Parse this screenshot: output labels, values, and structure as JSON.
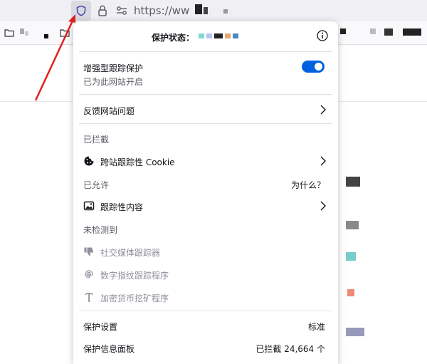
{
  "browser": {
    "url": "https://ww"
  },
  "panel": {
    "header": {
      "status_label": "保护状态："
    },
    "enhanced": {
      "title": "增强型跟踪保护",
      "subtitle": "已为此网站开启",
      "enabled": true
    },
    "report": {
      "label": "反馈网站问题"
    },
    "blocked_section": {
      "label": "已拦截"
    },
    "blocked_items": [
      {
        "label": "跨站跟踪性 Cookie",
        "icon": "cookie-icon"
      }
    ],
    "allowed_section": {
      "label": "已允许",
      "why_link": "为什么？"
    },
    "allowed_items": [
      {
        "label": "跟踪性内容",
        "icon": "image-icon"
      }
    ],
    "not_detected_section": {
      "label": "未检测到"
    },
    "not_detected_items": [
      {
        "label": "社交媒体跟踪器",
        "icon": "thumbs-down-icon"
      },
      {
        "label": "数字指纹跟踪程序",
        "icon": "fingerprint-icon"
      },
      {
        "label": "加密货币挖矿程序",
        "icon": "pickaxe-icon"
      }
    ],
    "settings": {
      "label": "保护设置",
      "value": "标准"
    },
    "dashboard": {
      "label": "保护信息面板",
      "value": "已拦截 24,664 个"
    }
  },
  "colors": {
    "accent": "#0061e0",
    "arrow": "#e02020"
  }
}
